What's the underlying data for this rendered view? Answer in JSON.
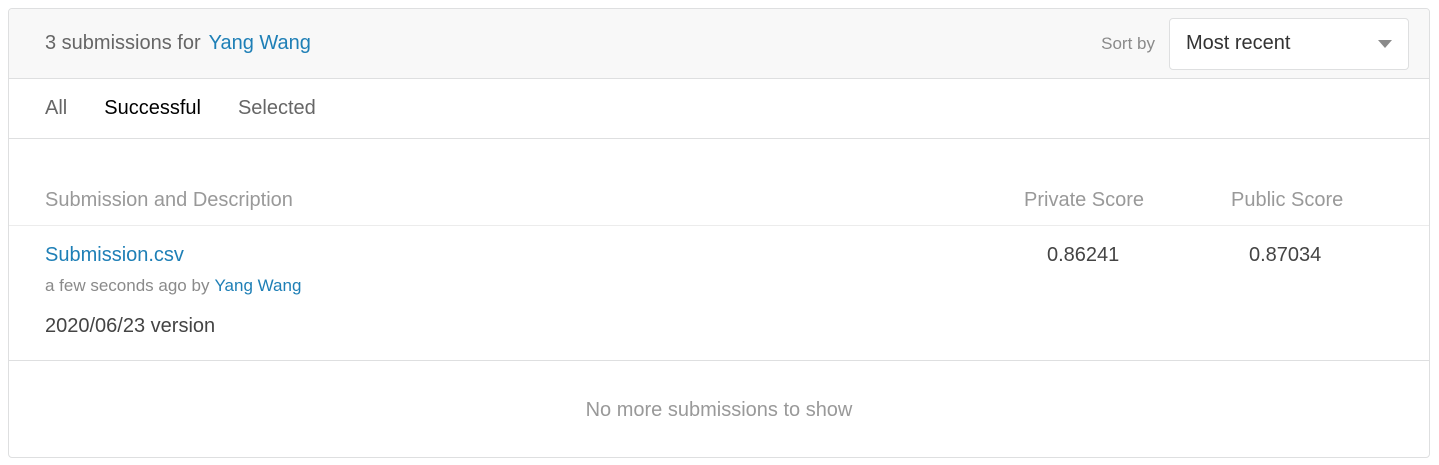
{
  "header": {
    "title_prefix": "3 submissions for",
    "user_name": "Yang Wang",
    "sort_label": "Sort by",
    "sort_value": "Most recent"
  },
  "tabs": [
    {
      "label": "All",
      "active": false
    },
    {
      "label": "Successful",
      "active": true
    },
    {
      "label": "Selected",
      "active": false
    }
  ],
  "table": {
    "columns": {
      "description": "Submission and Description",
      "private_score": "Private Score",
      "public_score": "Public Score"
    },
    "rows": [
      {
        "file_name": "Submission.csv",
        "time_text": "a few seconds ago by",
        "author": "Yang Wang",
        "description": "2020/06/23 version",
        "private_score": "0.86241",
        "public_score": "0.87034"
      }
    ]
  },
  "footer": {
    "message": "No more submissions to show"
  },
  "colors": {
    "link": "#1e7fb6",
    "border": "#dedfe0",
    "header_bg": "#f8f8f8"
  },
  "icons": {
    "sort_caret": "chevron-down-icon"
  }
}
